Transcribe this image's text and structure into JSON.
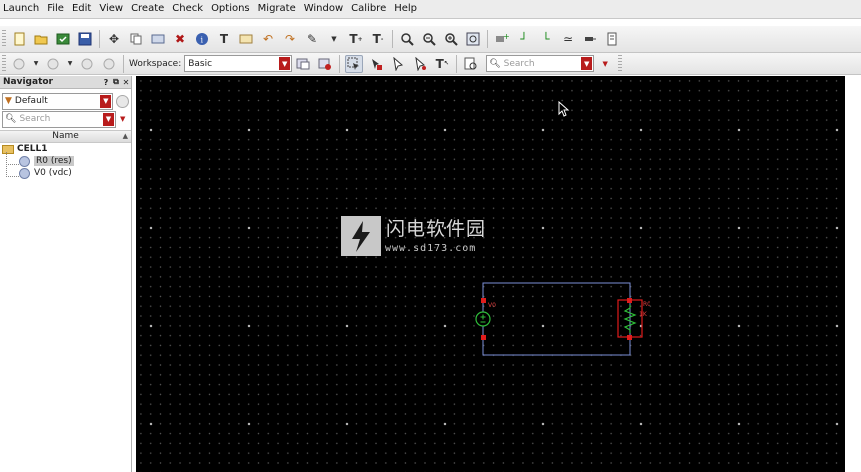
{
  "menubar": {
    "items": [
      "Launch",
      "File",
      "Edit",
      "View",
      "Create",
      "Check",
      "Options",
      "Migrate",
      "Window",
      "Calibre",
      "Help"
    ]
  },
  "toolbar2": {
    "workspace_label": "Workspace:",
    "workspace_value": "Basic",
    "search_placeholder": "Search"
  },
  "navigator": {
    "title": "Navigator",
    "filter_value": "Default",
    "search_placeholder": "Search",
    "column_header": "Name",
    "tree": {
      "cell": "CELL1",
      "instances": [
        {
          "label": "R0 (res)",
          "selected": true
        },
        {
          "label": "V0 (vdc)",
          "selected": false
        }
      ]
    }
  },
  "canvas": {
    "watermark_title": "闪电软件园",
    "watermark_url": "www.sd173.com",
    "wire_color": "#7b8fd8",
    "pin_color": "#e01c1c",
    "component_color": "#2fbf3a",
    "schematic_labels": {
      "vsource": "V0",
      "resistor_name": "R0",
      "resistor_value": "1K"
    }
  },
  "colors": {
    "canvas_background": "#000000",
    "accent": "#b81c1c"
  }
}
